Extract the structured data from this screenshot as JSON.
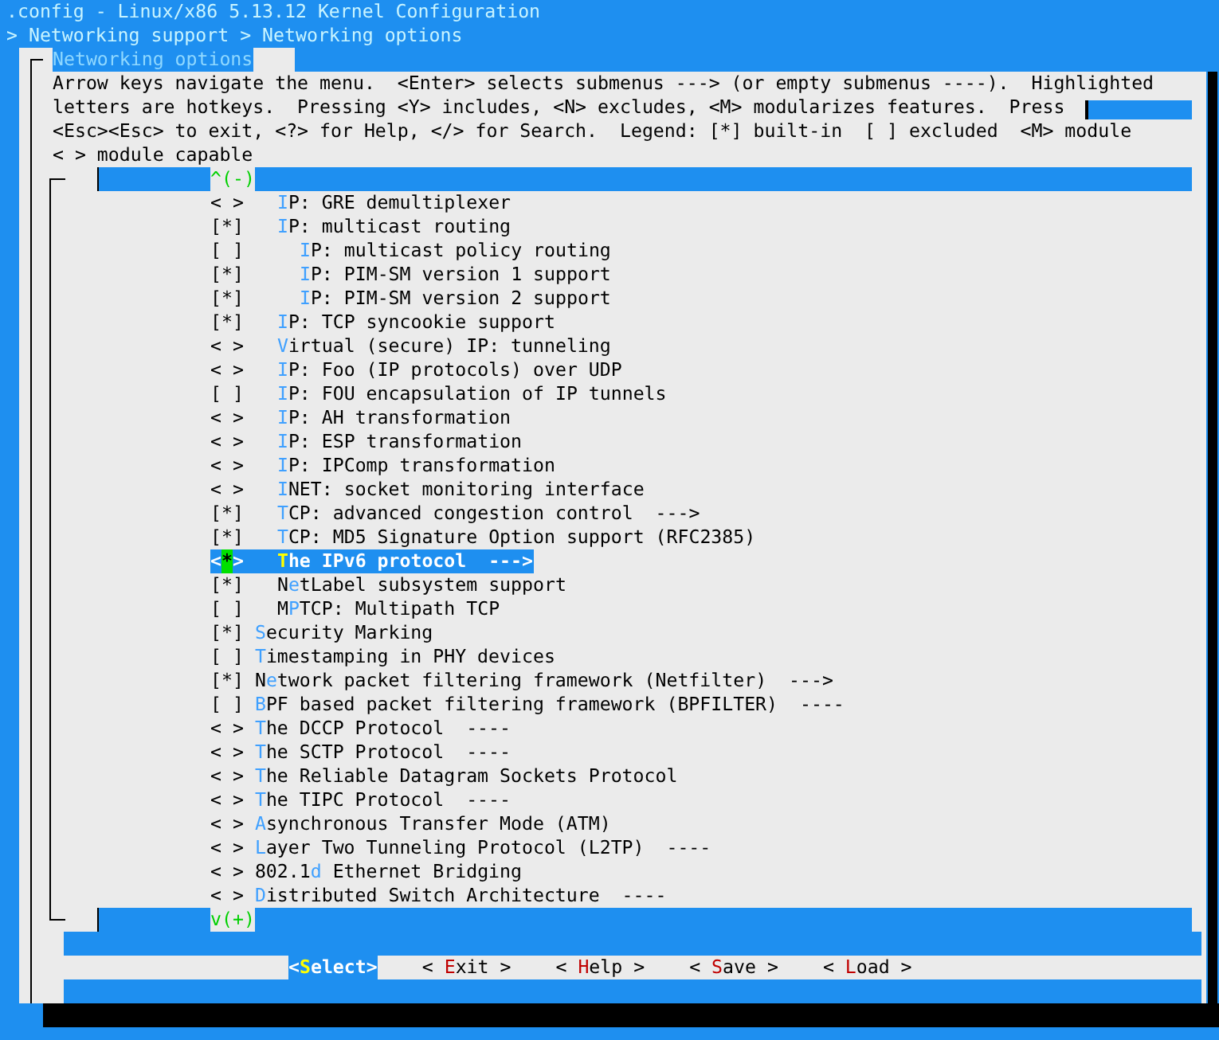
{
  "window": {
    "title": ".config - Linux/x86 5.13.12 Kernel Configuration",
    "breadcrumb": "> Networking support > Networking options"
  },
  "dialog": {
    "title": "Networking options",
    "help_lines": [
      "Arrow keys navigate the menu.  <Enter> selects submenus ---> (or empty submenus ----).  Highlighted",
      "letters are hotkeys.  Pressing <Y> includes, <N> excludes, <M> modularizes features.  Press",
      "<Esc><Esc> to exit, <?> for Help, </> for Search.  Legend: [*] built-in  [ ] excluded  <M> module",
      "< > module capable"
    ],
    "scroll_up": "^(-)",
    "scroll_down": "v(+)",
    "menu": [
      {
        "kind": "continuation",
        "children": [
          {
            "mark": "< >",
            "hotkey": "I",
            "after": "P: GRE demultiplexer",
            "selected": false
          },
          {
            "mark": "[*]",
            "hotkey": "I",
            "after": "P: multicast routing",
            "selected": false,
            "children": [
              {
                "mark": "[ ]",
                "hotkey": "I",
                "after": "P: multicast policy routing",
                "selected": false
              },
              {
                "mark": "[*]",
                "hotkey": "I",
                "after": "P: PIM-SM version 1 support",
                "selected": false
              },
              {
                "mark": "[*]",
                "hotkey": "I",
                "after": "P: PIM-SM version 2 support",
                "selected": false
              }
            ]
          },
          {
            "mark": "[*]",
            "hotkey": "I",
            "after": "P: TCP syncookie support",
            "selected": false
          },
          {
            "mark": "< >",
            "hotkey": "V",
            "after": "irtual (secure) IP: tunneling",
            "selected": false
          },
          {
            "mark": "< >",
            "hotkey": "I",
            "after": "P: Foo (IP protocols) over UDP",
            "selected": false
          },
          {
            "mark": "[ ]",
            "hotkey": "I",
            "after": "P: FOU encapsulation of IP tunnels",
            "selected": false
          },
          {
            "mark": "< >",
            "hotkey": "I",
            "after": "P: AH transformation",
            "selected": false
          },
          {
            "mark": "< >",
            "hotkey": "I",
            "after": "P: ESP transformation",
            "selected": false
          },
          {
            "mark": "< >",
            "hotkey": "I",
            "after": "P: IPComp transformation",
            "selected": false
          },
          {
            "mark": "< >",
            "hotkey": "I",
            "after": "NET: socket monitoring interface",
            "selected": false
          },
          {
            "mark": "[*]",
            "hotkey": "T",
            "after": "CP: advanced congestion control  --->",
            "selected": false
          },
          {
            "mark": "[*]",
            "hotkey": "T",
            "after": "CP: MD5 Signature Option support (RFC2385)",
            "selected": false
          },
          {
            "mark": "<*>",
            "hotkey": "T",
            "after": "he IPv6 protocol  --->",
            "selected": true
          },
          {
            "mark": "[*]",
            "before": "N",
            "hotkey": "e",
            "after": "tLabel subsystem support",
            "selected": false
          },
          {
            "mark": "[ ]",
            "before": "M",
            "hotkey": "P",
            "after": "TCP: Multipath TCP",
            "selected": false
          }
        ]
      },
      {
        "kind": "option",
        "mark": "[*]",
        "hotkey": "S",
        "after": "ecurity Marking",
        "selected": false
      },
      {
        "kind": "option",
        "mark": "[ ]",
        "hotkey": "T",
        "after": "imestamping in PHY devices",
        "selected": false
      },
      {
        "kind": "option",
        "mark": "[*]",
        "before": "N",
        "hotkey": "e",
        "after": "twork packet filtering framework (Netfilter)  --->",
        "selected": false
      },
      {
        "kind": "option",
        "mark": "[ ]",
        "hotkey": "B",
        "after": "PF based packet filtering framework (BPFILTER)  ----",
        "selected": false
      },
      {
        "kind": "option",
        "mark": "< >",
        "hotkey": "T",
        "after": "he DCCP Protocol  ----",
        "selected": false
      },
      {
        "kind": "option",
        "mark": "< >",
        "hotkey": "T",
        "after": "he SCTP Protocol  ----",
        "selected": false
      },
      {
        "kind": "option",
        "mark": "< >",
        "hotkey": "T",
        "after": "he Reliable Datagram Sockets Protocol",
        "selected": false
      },
      {
        "kind": "option",
        "mark": "< >",
        "hotkey": "T",
        "after": "he TIPC Protocol  ----",
        "selected": false
      },
      {
        "kind": "option",
        "mark": "< >",
        "hotkey": "A",
        "after": "synchronous Transfer Mode (ATM)",
        "selected": false
      },
      {
        "kind": "option",
        "mark": "< >",
        "hotkey": "L",
        "after": "ayer Two Tunneling Protocol (L2TP)  ----",
        "selected": false
      },
      {
        "kind": "option",
        "mark": "< >",
        "before": "802.1",
        "hotkey": "d",
        "after": " Ethernet Bridging",
        "selected": false
      },
      {
        "kind": "option",
        "mark": "< >",
        "hotkey": "D",
        "after": "istributed Switch Architecture  ----",
        "selected": false
      }
    ],
    "buttons": [
      {
        "before": "<",
        "hotkey": "S",
        "after": "elect>",
        "selected": true
      },
      {
        "before": "< ",
        "hotkey": "E",
        "after": "xit >",
        "selected": false
      },
      {
        "before": "< ",
        "hotkey": "H",
        "after": "elp >",
        "selected": false
      },
      {
        "before": "< ",
        "hotkey": "S",
        "after": "ave >",
        "selected": false
      },
      {
        "before": "< ",
        "hotkey": "L",
        "after": "oad >",
        "selected": false
      }
    ]
  }
}
